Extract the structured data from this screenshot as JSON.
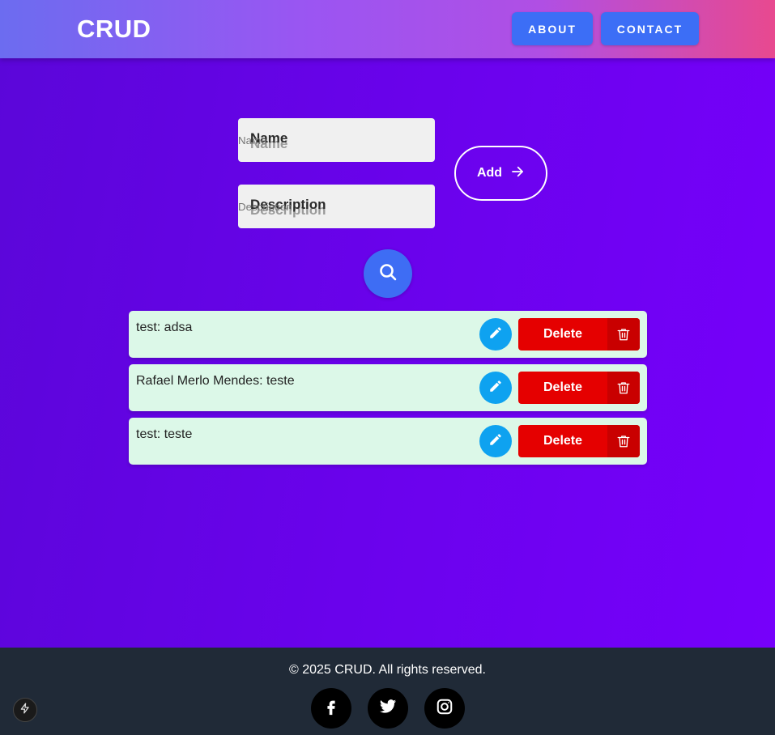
{
  "navbar": {
    "brand": "CRUD",
    "links": [
      {
        "label": "ABOUT"
      },
      {
        "label": "CONTACT"
      }
    ]
  },
  "form": {
    "name_label": "Name",
    "name_placeholder": "Name",
    "description_label": "Description",
    "description_placeholder": "Description",
    "add_label": "Add"
  },
  "items": [
    {
      "text": "test: adsa",
      "delete_label": "Delete"
    },
    {
      "text": "Rafael Merlo Mendes: teste",
      "delete_label": "Delete"
    },
    {
      "text": "test: teste",
      "delete_label": "Delete"
    }
  ],
  "footer": {
    "copyright": "© 2025 CRUD. All rights reserved.",
    "social": [
      "facebook-icon",
      "twitter-icon",
      "instagram-icon"
    ]
  },
  "colors": {
    "nav_button": "#3c6ef6",
    "search_button": "#3e6df4",
    "edit_button": "#0ea2f0",
    "delete_button": "#e50000",
    "item_bg": "#dcf8e8",
    "footer_bg": "#202a37"
  }
}
